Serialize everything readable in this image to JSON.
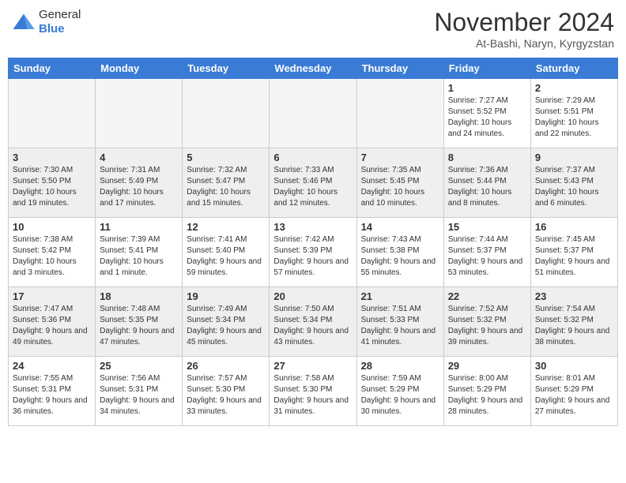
{
  "header": {
    "logo_general": "General",
    "logo_blue": "Blue",
    "month_title": "November 2024",
    "location": "At-Bashi, Naryn, Kyrgyzstan"
  },
  "days_of_week": [
    "Sunday",
    "Monday",
    "Tuesday",
    "Wednesday",
    "Thursday",
    "Friday",
    "Saturday"
  ],
  "weeks": [
    [
      {
        "day": "",
        "empty": true
      },
      {
        "day": "",
        "empty": true
      },
      {
        "day": "",
        "empty": true
      },
      {
        "day": "",
        "empty": true
      },
      {
        "day": "",
        "empty": true
      },
      {
        "day": "1",
        "sunrise": "Sunrise: 7:27 AM",
        "sunset": "Sunset: 5:52 PM",
        "daylight": "Daylight: 10 hours and 24 minutes."
      },
      {
        "day": "2",
        "sunrise": "Sunrise: 7:29 AM",
        "sunset": "Sunset: 5:51 PM",
        "daylight": "Daylight: 10 hours and 22 minutes."
      }
    ],
    [
      {
        "day": "3",
        "sunrise": "Sunrise: 7:30 AM",
        "sunset": "Sunset: 5:50 PM",
        "daylight": "Daylight: 10 hours and 19 minutes."
      },
      {
        "day": "4",
        "sunrise": "Sunrise: 7:31 AM",
        "sunset": "Sunset: 5:49 PM",
        "daylight": "Daylight: 10 hours and 17 minutes."
      },
      {
        "day": "5",
        "sunrise": "Sunrise: 7:32 AM",
        "sunset": "Sunset: 5:47 PM",
        "daylight": "Daylight: 10 hours and 15 minutes."
      },
      {
        "day": "6",
        "sunrise": "Sunrise: 7:33 AM",
        "sunset": "Sunset: 5:46 PM",
        "daylight": "Daylight: 10 hours and 12 minutes."
      },
      {
        "day": "7",
        "sunrise": "Sunrise: 7:35 AM",
        "sunset": "Sunset: 5:45 PM",
        "daylight": "Daylight: 10 hours and 10 minutes."
      },
      {
        "day": "8",
        "sunrise": "Sunrise: 7:36 AM",
        "sunset": "Sunset: 5:44 PM",
        "daylight": "Daylight: 10 hours and 8 minutes."
      },
      {
        "day": "9",
        "sunrise": "Sunrise: 7:37 AM",
        "sunset": "Sunset: 5:43 PM",
        "daylight": "Daylight: 10 hours and 6 minutes."
      }
    ],
    [
      {
        "day": "10",
        "sunrise": "Sunrise: 7:38 AM",
        "sunset": "Sunset: 5:42 PM",
        "daylight": "Daylight: 10 hours and 3 minutes."
      },
      {
        "day": "11",
        "sunrise": "Sunrise: 7:39 AM",
        "sunset": "Sunset: 5:41 PM",
        "daylight": "Daylight: 10 hours and 1 minute."
      },
      {
        "day": "12",
        "sunrise": "Sunrise: 7:41 AM",
        "sunset": "Sunset: 5:40 PM",
        "daylight": "Daylight: 9 hours and 59 minutes."
      },
      {
        "day": "13",
        "sunrise": "Sunrise: 7:42 AM",
        "sunset": "Sunset: 5:39 PM",
        "daylight": "Daylight: 9 hours and 57 minutes."
      },
      {
        "day": "14",
        "sunrise": "Sunrise: 7:43 AM",
        "sunset": "Sunset: 5:38 PM",
        "daylight": "Daylight: 9 hours and 55 minutes."
      },
      {
        "day": "15",
        "sunrise": "Sunrise: 7:44 AM",
        "sunset": "Sunset: 5:37 PM",
        "daylight": "Daylight: 9 hours and 53 minutes."
      },
      {
        "day": "16",
        "sunrise": "Sunrise: 7:45 AM",
        "sunset": "Sunset: 5:37 PM",
        "daylight": "Daylight: 9 hours and 51 minutes."
      }
    ],
    [
      {
        "day": "17",
        "sunrise": "Sunrise: 7:47 AM",
        "sunset": "Sunset: 5:36 PM",
        "daylight": "Daylight: 9 hours and 49 minutes."
      },
      {
        "day": "18",
        "sunrise": "Sunrise: 7:48 AM",
        "sunset": "Sunset: 5:35 PM",
        "daylight": "Daylight: 9 hours and 47 minutes."
      },
      {
        "day": "19",
        "sunrise": "Sunrise: 7:49 AM",
        "sunset": "Sunset: 5:34 PM",
        "daylight": "Daylight: 9 hours and 45 minutes."
      },
      {
        "day": "20",
        "sunrise": "Sunrise: 7:50 AM",
        "sunset": "Sunset: 5:34 PM",
        "daylight": "Daylight: 9 hours and 43 minutes."
      },
      {
        "day": "21",
        "sunrise": "Sunrise: 7:51 AM",
        "sunset": "Sunset: 5:33 PM",
        "daylight": "Daylight: 9 hours and 41 minutes."
      },
      {
        "day": "22",
        "sunrise": "Sunrise: 7:52 AM",
        "sunset": "Sunset: 5:32 PM",
        "daylight": "Daylight: 9 hours and 39 minutes."
      },
      {
        "day": "23",
        "sunrise": "Sunrise: 7:54 AM",
        "sunset": "Sunset: 5:32 PM",
        "daylight": "Daylight: 9 hours and 38 minutes."
      }
    ],
    [
      {
        "day": "24",
        "sunrise": "Sunrise: 7:55 AM",
        "sunset": "Sunset: 5:31 PM",
        "daylight": "Daylight: 9 hours and 36 minutes."
      },
      {
        "day": "25",
        "sunrise": "Sunrise: 7:56 AM",
        "sunset": "Sunset: 5:31 PM",
        "daylight": "Daylight: 9 hours and 34 minutes."
      },
      {
        "day": "26",
        "sunrise": "Sunrise: 7:57 AM",
        "sunset": "Sunset: 5:30 PM",
        "daylight": "Daylight: 9 hours and 33 minutes."
      },
      {
        "day": "27",
        "sunrise": "Sunrise: 7:58 AM",
        "sunset": "Sunset: 5:30 PM",
        "daylight": "Daylight: 9 hours and 31 minutes."
      },
      {
        "day": "28",
        "sunrise": "Sunrise: 7:59 AM",
        "sunset": "Sunset: 5:29 PM",
        "daylight": "Daylight: 9 hours and 30 minutes."
      },
      {
        "day": "29",
        "sunrise": "Sunrise: 8:00 AM",
        "sunset": "Sunset: 5:29 PM",
        "daylight": "Daylight: 9 hours and 28 minutes."
      },
      {
        "day": "30",
        "sunrise": "Sunrise: 8:01 AM",
        "sunset": "Sunset: 5:29 PM",
        "daylight": "Daylight: 9 hours and 27 minutes."
      }
    ]
  ]
}
